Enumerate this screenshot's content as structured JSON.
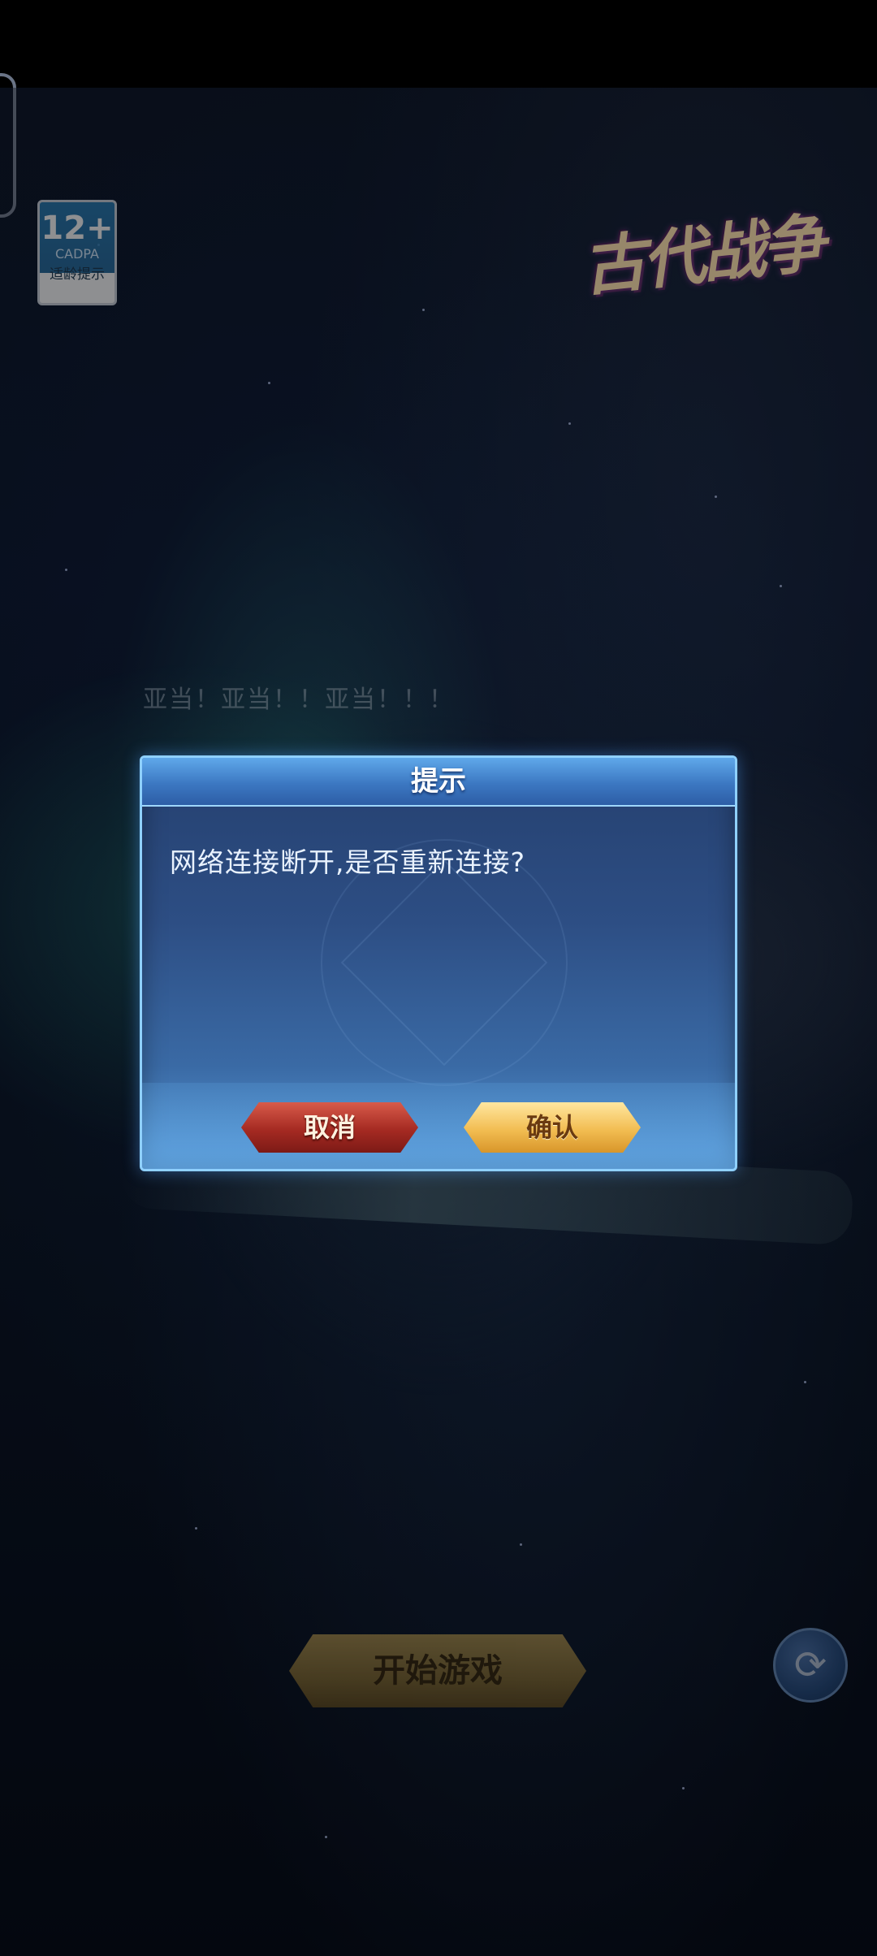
{
  "status_bar": {},
  "age_badge": {
    "age": "12+",
    "org": "CADPA",
    "tip": "适龄提示"
  },
  "game": {
    "logo": "古代战争",
    "chat_text": "亚当！亚当！！亚当！！！",
    "start_label": "开始游戏",
    "refresh_icon": "refresh-icon"
  },
  "dialog": {
    "title": "提示",
    "message": "网络连接断开,是否重新连接?",
    "cancel_label": "取消",
    "confirm_label": "确认"
  },
  "colors": {
    "dialog_bg": "#2d4e84",
    "cancel": "#a52a22",
    "confirm": "#f2bd52"
  }
}
